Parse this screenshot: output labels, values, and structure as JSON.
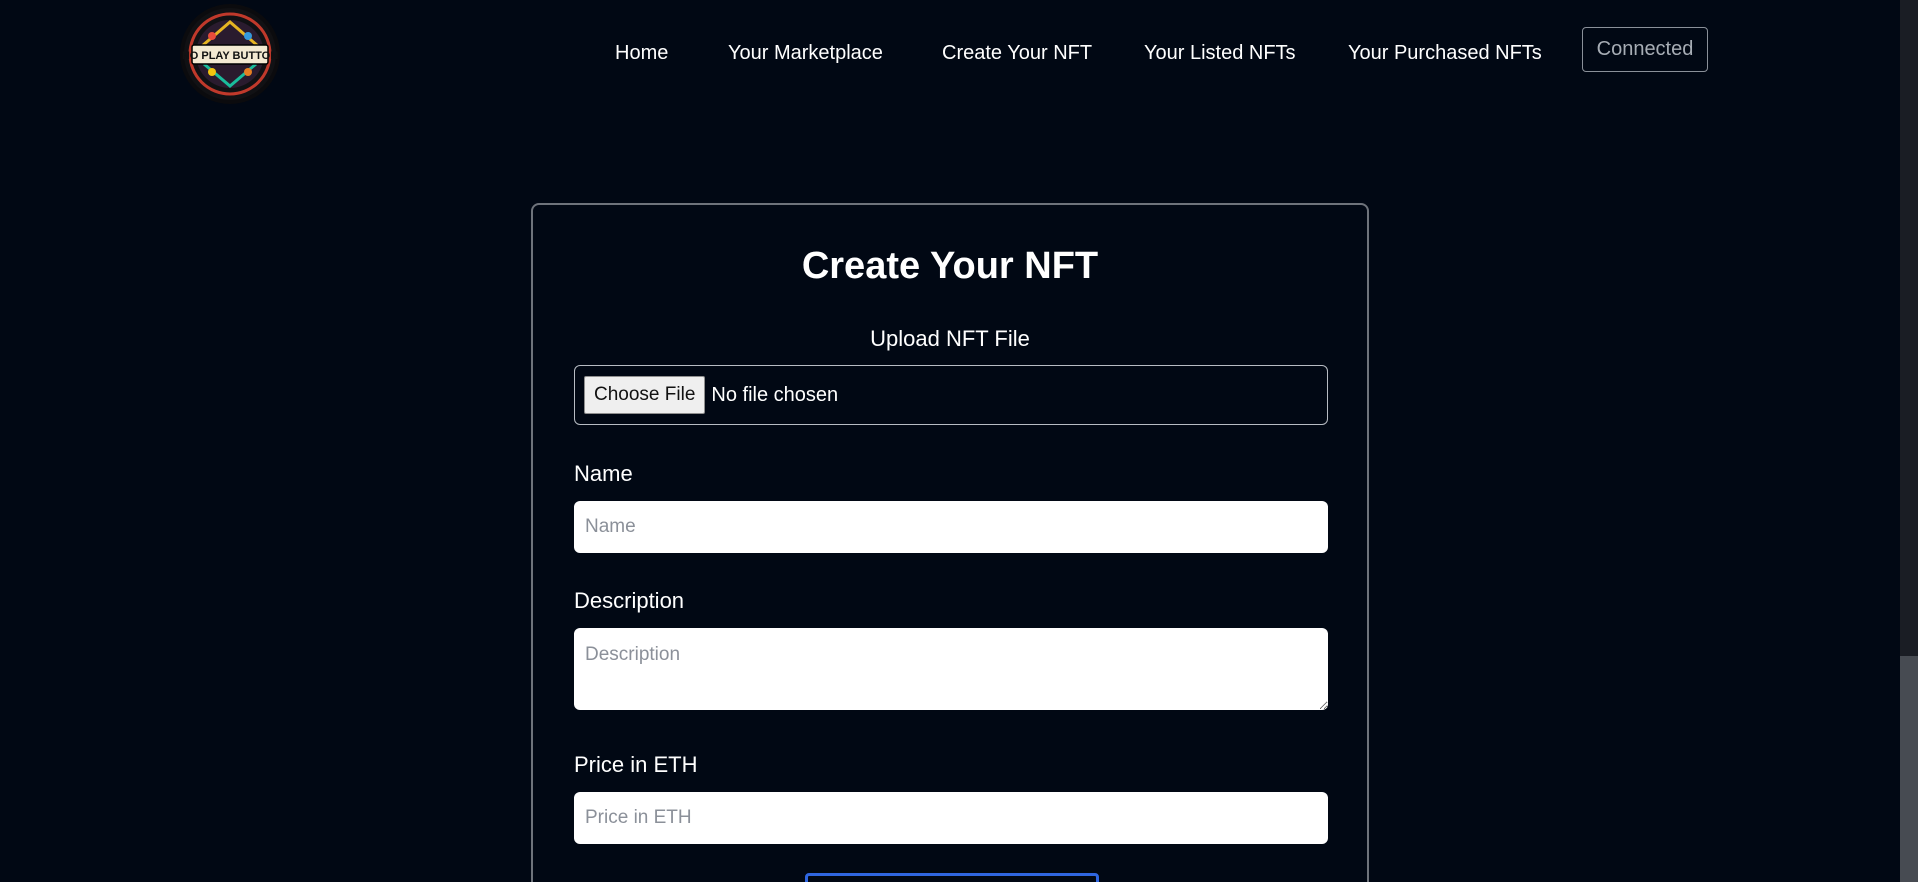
{
  "header": {
    "logo_text": "NO PLAY BUTTON",
    "nav": [
      {
        "label": "Home"
      },
      {
        "label": "Your Marketplace"
      },
      {
        "label": "Create Your NFT"
      },
      {
        "label": "Your Listed NFTs"
      },
      {
        "label": "Your Purchased NFTs"
      }
    ],
    "connect_label": "Connected"
  },
  "form": {
    "title": "Create Your NFT",
    "upload_label": "Upload NFT File",
    "choose_file_label": "Choose File",
    "file_status": "No file chosen",
    "name_label": "Name",
    "name_placeholder": "Name",
    "name_value": "",
    "description_label": "Description",
    "description_placeholder": "Description",
    "description_value": "",
    "price_label": "Price in ETH",
    "price_placeholder": "Price in ETH",
    "price_value": ""
  },
  "colors": {
    "background": "#010814",
    "card_border": "#6e737b",
    "submit_border": "#2f66e0",
    "connected_text": "#a7adb5"
  }
}
